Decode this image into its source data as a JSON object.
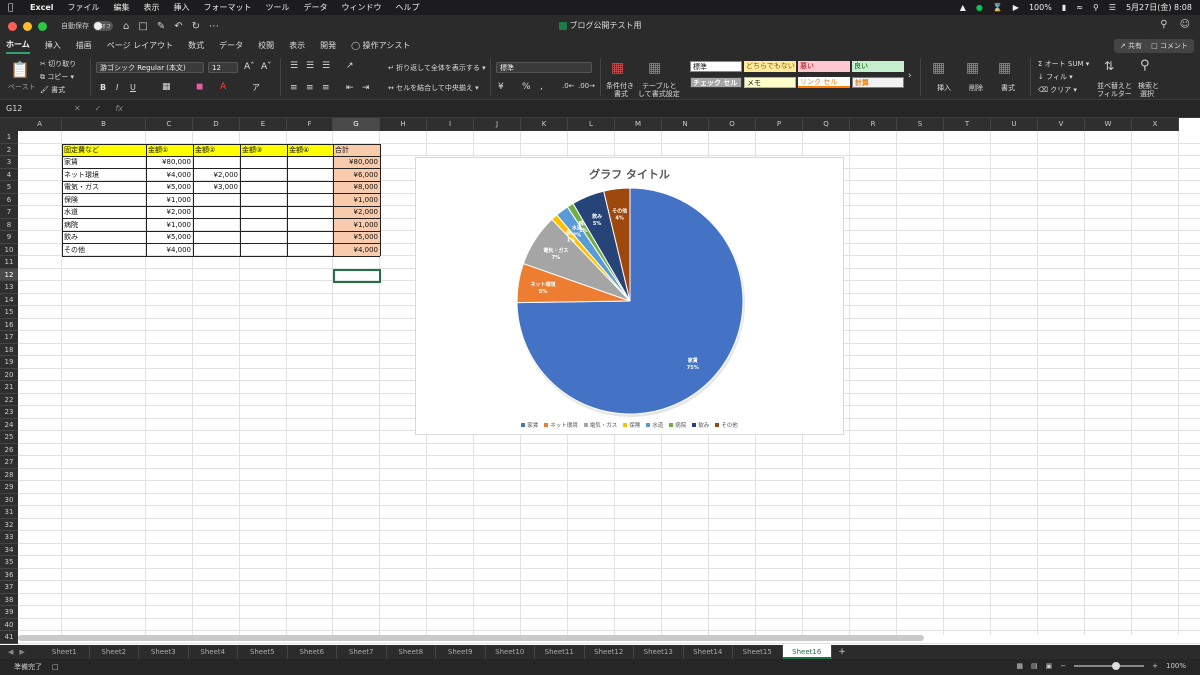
{
  "menubar": {
    "app": "Excel",
    "items": [
      "ファイル",
      "編集",
      "表示",
      "挿入",
      "フォーマット",
      "ツール",
      "データ",
      "ウィンドウ",
      "ヘルプ"
    ],
    "battery": "100%",
    "datetime": "5月27日(金)  8:08"
  },
  "titlebar": {
    "autosave_label": "自動保存",
    "autosave_state": "オフ",
    "doc_title": "ブログ公開テスト用"
  },
  "tabs": {
    "items": [
      "ホーム",
      "挿入",
      "描画",
      "ページ レイアウト",
      "数式",
      "データ",
      "校閲",
      "表示",
      "開発"
    ],
    "assist": "操作アシスト",
    "share": "共有",
    "comment": "コメント"
  },
  "ribbon": {
    "paste": "ペースト",
    "cut": "切り取り",
    "copy": "コピー",
    "format_painter": "書式",
    "font_name": "游ゴシック Regular (本文)",
    "font_size": "12",
    "wrap_text": "折り返して全体を表示する",
    "merge_center": "セルを結合して中央揃え",
    "number_format": "標準",
    "cond_format_1": "条件付き",
    "cond_format_2": "書式",
    "table_format_1": "テーブルと",
    "table_format_2": "して書式設定",
    "styles": {
      "standard": "標準",
      "neutral": "どちらでもない",
      "bad": "悪い",
      "good": "良い",
      "check": "チェック セル",
      "memo": "メモ",
      "link": "リンク セル",
      "calc": "計算"
    },
    "insert": "挿入",
    "delete": "削除",
    "format": "書式",
    "autosum": "オート SUM",
    "fill": "フィル",
    "clear": "クリア",
    "sort_1": "並べ替えと",
    "sort_2": "フィルター",
    "find_1": "検索と",
    "find_2": "選択"
  },
  "formula_bar": {
    "name_box": "G12",
    "fx": "fx",
    "content": ""
  },
  "columns": [
    "A",
    "B",
    "C",
    "D",
    "E",
    "F",
    "G",
    "H",
    "I",
    "J",
    "K",
    "L",
    "M",
    "N",
    "O",
    "P",
    "Q",
    "R",
    "S",
    "T",
    "U",
    "V",
    "W",
    "X"
  ],
  "rows": [
    "1",
    "2",
    "3",
    "4",
    "5",
    "6",
    "7",
    "8",
    "9",
    "10",
    "11",
    "12",
    "13",
    "14",
    "15",
    "16",
    "17",
    "18",
    "19",
    "20",
    "21",
    "22",
    "23",
    "24",
    "25",
    "26",
    "27",
    "28",
    "29",
    "30",
    "31",
    "32",
    "33",
    "34",
    "35",
    "36",
    "37",
    "38",
    "39",
    "40",
    "41"
  ],
  "table": {
    "headers": [
      "固定費など",
      "金額①",
      "金額②",
      "金額③",
      "金額④",
      "合計"
    ],
    "rows": [
      {
        "name": "家賃",
        "c": "¥80,000",
        "d": "",
        "e": "",
        "f": "",
        "g": "¥80,000"
      },
      {
        "name": "ネット環境",
        "c": "¥4,000",
        "d": "¥2,000",
        "e": "",
        "f": "",
        "g": "¥6,000"
      },
      {
        "name": "電気・ガス",
        "c": "¥5,000",
        "d": "¥3,000",
        "e": "",
        "f": "",
        "g": "¥8,000"
      },
      {
        "name": "保険",
        "c": "¥1,000",
        "d": "",
        "e": "",
        "f": "",
        "g": "¥1,000"
      },
      {
        "name": "水道",
        "c": "¥2,000",
        "d": "",
        "e": "",
        "f": "",
        "g": "¥2,000"
      },
      {
        "name": "病院",
        "c": "¥1,000",
        "d": "",
        "e": "",
        "f": "",
        "g": "¥1,000"
      },
      {
        "name": "飲み",
        "c": "¥5,000",
        "d": "",
        "e": "",
        "f": "",
        "g": "¥5,000"
      },
      {
        "name": "その他",
        "c": "¥4,000",
        "d": "",
        "e": "",
        "f": "",
        "g": "¥4,000"
      }
    ]
  },
  "chart_data": {
    "type": "pie",
    "title": "グラフ タイトル",
    "categories": [
      "家賃",
      "ネット環境",
      "電気・ガス",
      "保険",
      "水道",
      "病院",
      "飲み",
      "その他"
    ],
    "values": [
      80000,
      6000,
      8000,
      1000,
      2000,
      1000,
      5000,
      4000
    ],
    "percent_labels": [
      "75%",
      "5%",
      "7%",
      "1%",
      "2%",
      "1%",
      "5%",
      "4%"
    ],
    "colors": [
      "#4472c4",
      "#ed7d31",
      "#a5a5a5",
      "#ffc000",
      "#5b9bd5",
      "#70ad47",
      "#264478",
      "#9e480e"
    ],
    "legend_position": "bottom"
  },
  "sheets": [
    "Sheet1",
    "Sheet2",
    "Sheet3",
    "Sheet4",
    "Sheet5",
    "Sheet6",
    "Sheet7",
    "Sheet8",
    "Sheet9",
    "Sheet10",
    "Sheet11",
    "Sheet12",
    "Sheet13",
    "Sheet14",
    "Sheet15",
    "Sheet16"
  ],
  "active_sheet": "Sheet16",
  "status": {
    "ready": "準備完了",
    "zoom": "100%"
  }
}
